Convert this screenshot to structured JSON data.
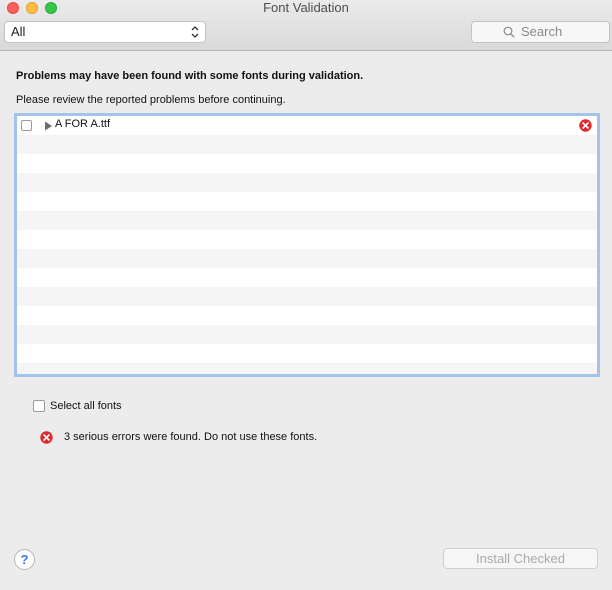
{
  "window": {
    "title": "Font Validation"
  },
  "toolbar": {
    "filter_selected": "All",
    "search_placeholder": "Search"
  },
  "main": {
    "heading": "Problems may have been found with some fonts during validation.",
    "subheading": "Please review the reported problems before continuing.",
    "fonts": [
      {
        "name": "A FOR A.ttf",
        "checked": false,
        "status": "error"
      }
    ],
    "select_all_label": "Select all fonts",
    "error_summary": "3 serious errors were found. Do not use these fonts."
  },
  "footer": {
    "help_label": "?",
    "install_label": "Install Checked"
  },
  "colors": {
    "error_red": "#e0282d",
    "list_focus_border": "#a3c4e8",
    "close_button": "#fc605c",
    "minimize_button": "#fdbc40",
    "zoom_button": "#34c84a"
  }
}
